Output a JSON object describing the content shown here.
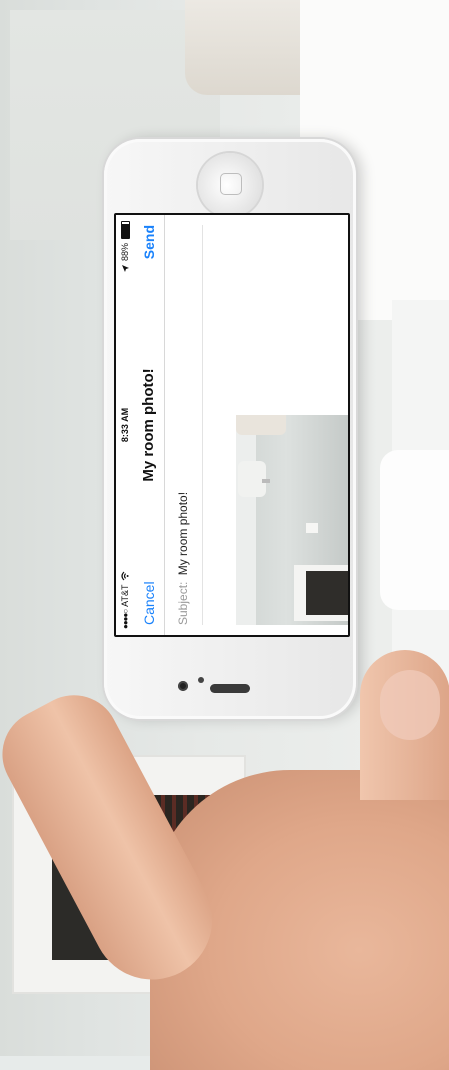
{
  "status_bar": {
    "signal_dots": "●●●●○",
    "carrier": "AT&T",
    "wifi_icon": "wifi-icon",
    "time": "8:33 AM",
    "location_icon": "location-arrow-icon",
    "battery_percent": "88%",
    "battery_level": 0.88
  },
  "compose": {
    "cancel_label": "Cancel",
    "title": "My room photo!",
    "send_label": "Send",
    "subject_label": "Subject:",
    "subject_value": "My room photo!"
  },
  "colors": {
    "ios_blue": "#1a82fb",
    "skin": "#e2aa8c"
  }
}
